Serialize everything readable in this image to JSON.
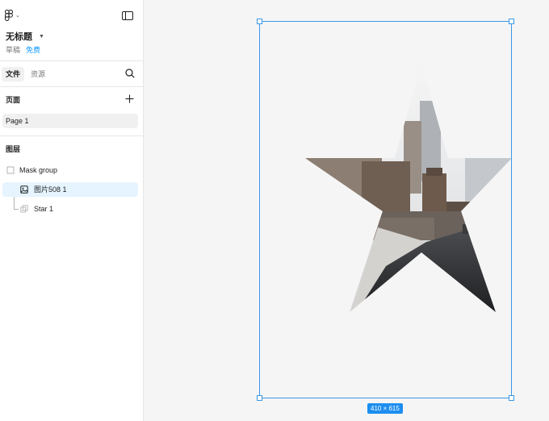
{
  "header": {
    "file_title": "无标题",
    "draft_label": "草稿",
    "plan_label": "免费"
  },
  "tabs": [
    {
      "label": "文件",
      "active": true
    },
    {
      "label": "资源",
      "active": false
    }
  ],
  "pages_section": {
    "title": "页面",
    "pages": [
      {
        "label": "Page 1",
        "selected": true
      }
    ]
  },
  "layers_section": {
    "title": "图层",
    "layers": [
      {
        "label": "Mask group",
        "icon": "mask-group-icon",
        "selected": false
      },
      {
        "label": "图片508 1",
        "icon": "image-icon",
        "selected": true
      },
      {
        "label": "Star 1",
        "icon": "star-shape-icon",
        "selected": false
      }
    ]
  },
  "canvas": {
    "selection_size_label": "410 × 615",
    "selection_color": "#3a98e8",
    "badge_color": "#1d8ef0"
  }
}
